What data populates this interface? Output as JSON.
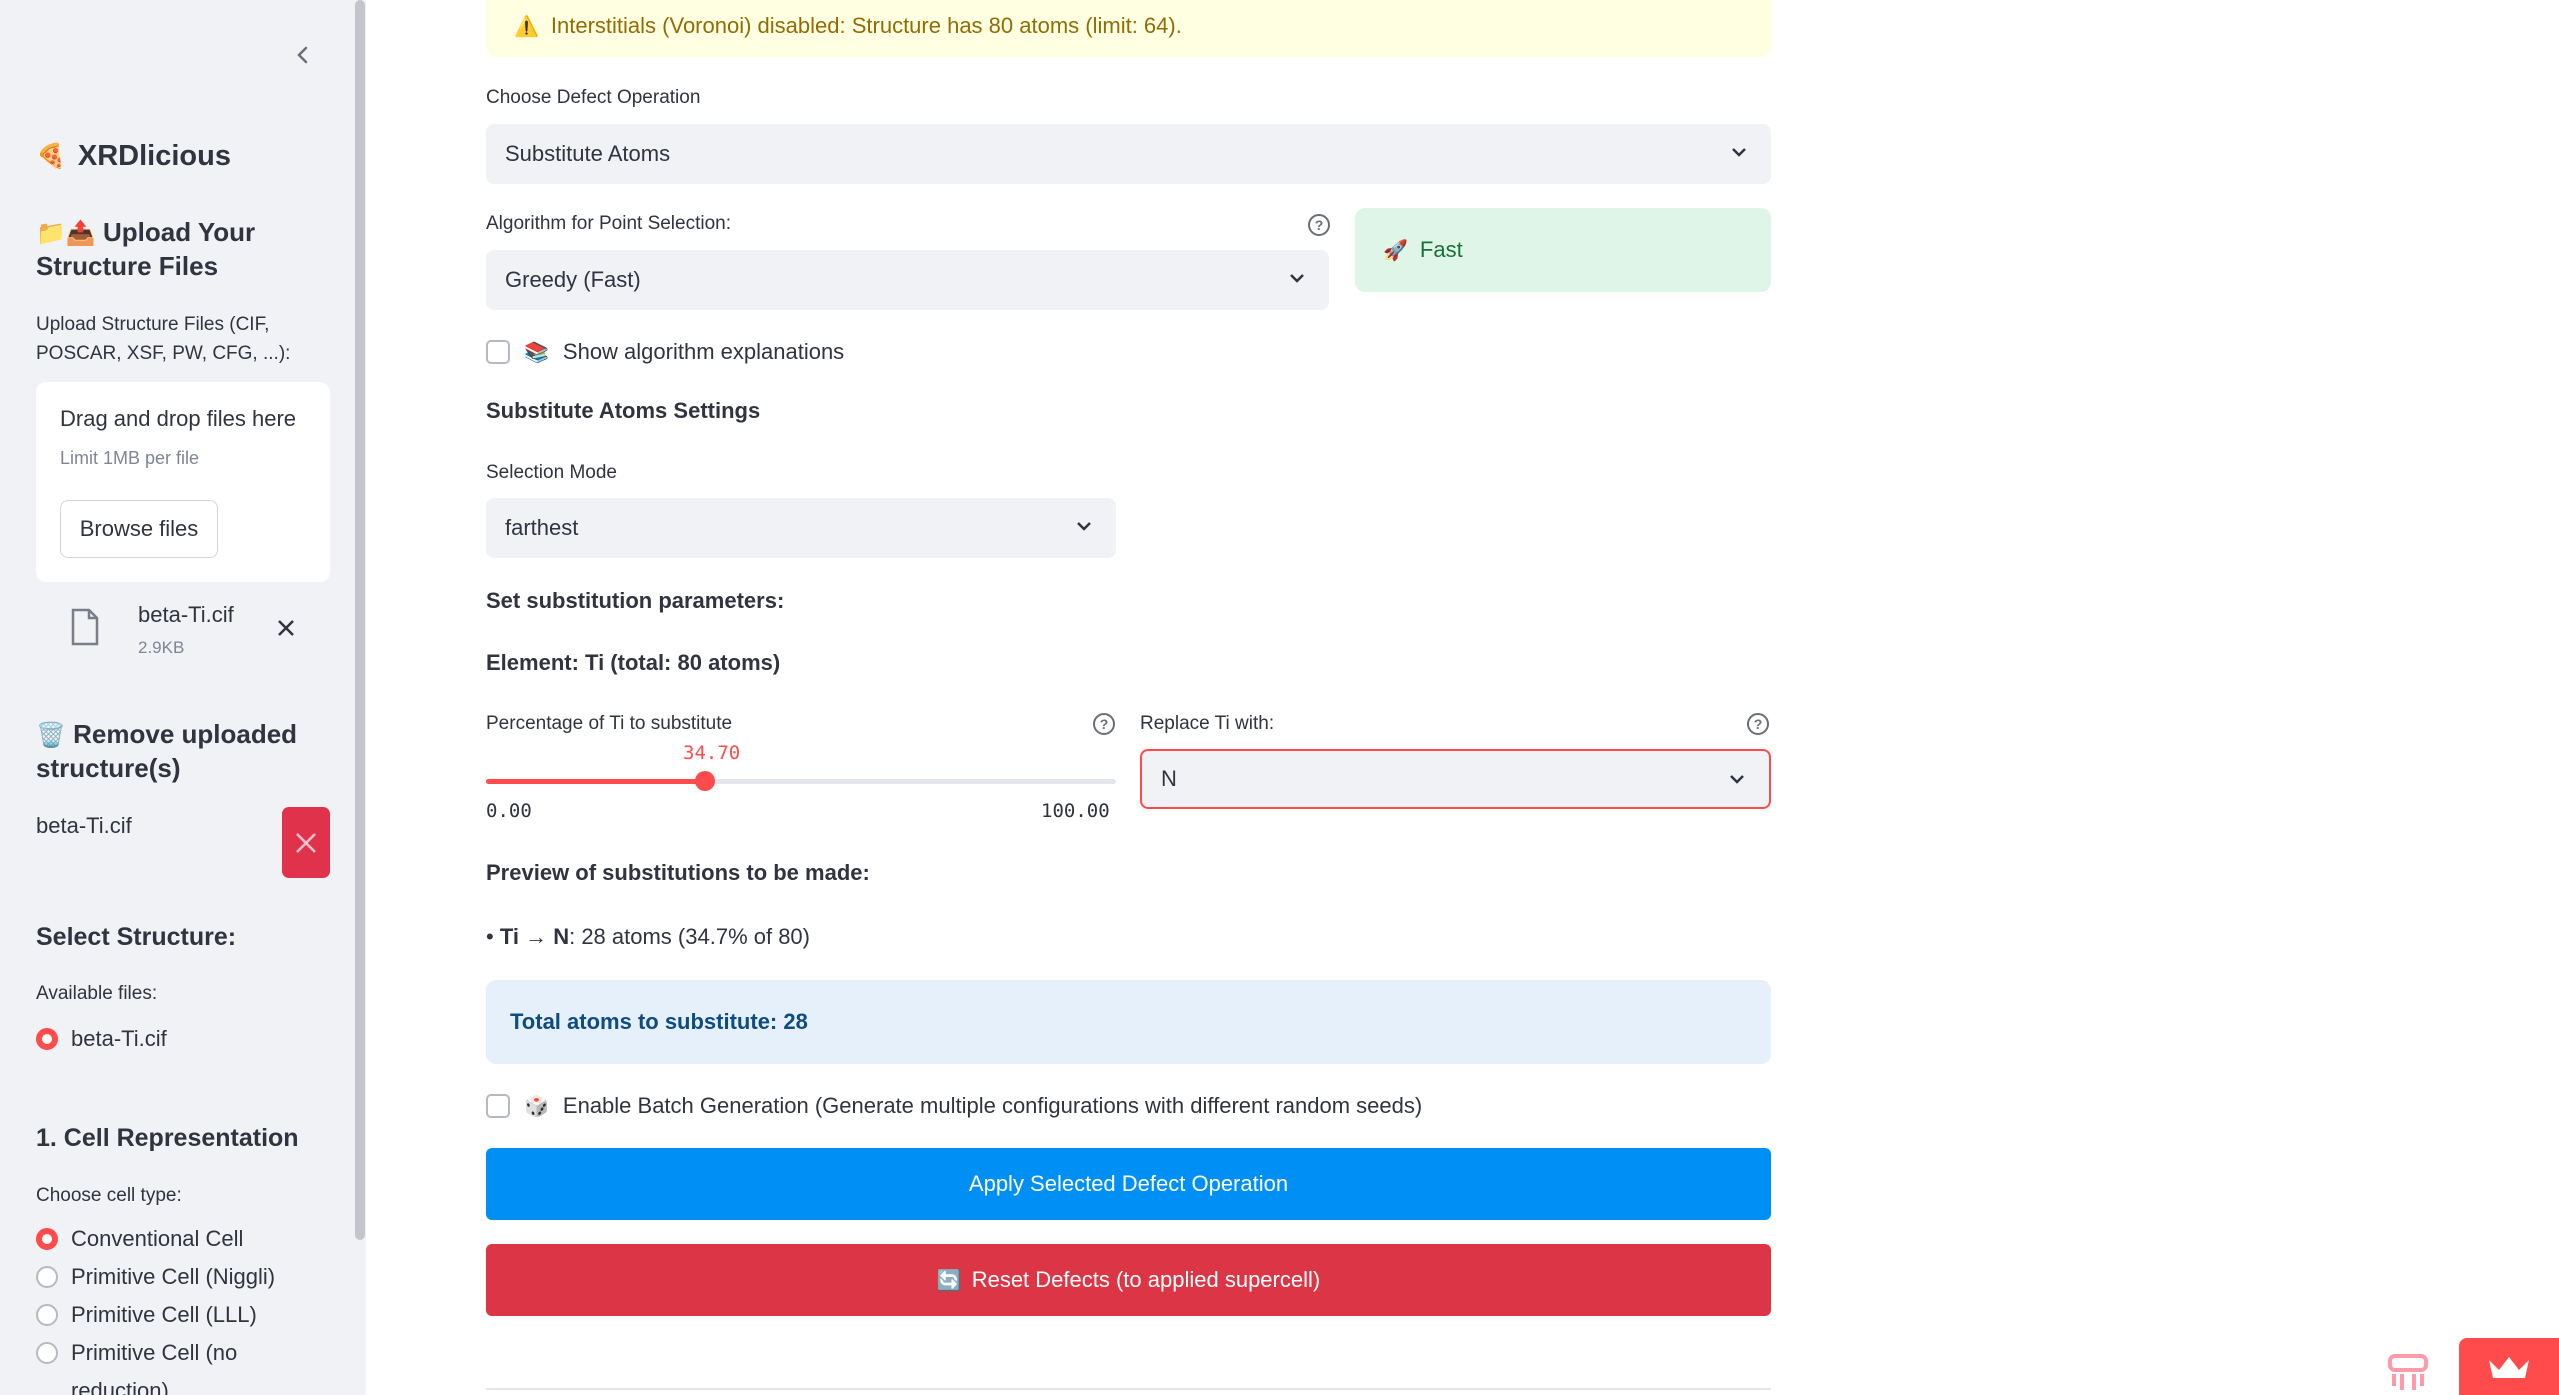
{
  "sidebar": {
    "brand": "XRDlicious",
    "upload_heading_line1": "Upload Your",
    "upload_heading_line2": "Structure Files",
    "upload_label_line1": "Upload Structure Files (CIF,",
    "upload_label_line2": "POSCAR, XSF, PW, CFG, ...):",
    "dropzone_title": "Drag and drop files here",
    "dropzone_limit": "Limit 1MB per file",
    "browse_label": "Browse files",
    "uploaded_file_name": "beta-Ti.cif",
    "uploaded_file_size": "2.9KB",
    "remove_heading_line1": "Remove uploaded",
    "remove_heading_line2": "structure(s)",
    "remove_file_name": "beta-Ti.cif",
    "select_heading": "Select Structure:",
    "available_label": "Available files:",
    "available_files": [
      "beta-Ti.cif"
    ],
    "cell_heading": "1. Cell Representation",
    "cell_type_label": "Choose cell type:",
    "cell_options": [
      "Conventional Cell",
      "Primitive Cell (Niggli)",
      "Primitive Cell (LLL)",
      "Primitive Cell (no",
      "reduction)"
    ],
    "cell_selected_index": 0
  },
  "main": {
    "warning_text": "Interstitials (Voronoi) disabled: Structure has 80 atoms (limit: 64).",
    "defect_op_label": "Choose Defect Operation",
    "defect_op_value": "Substitute Atoms",
    "algorithm_label": "Algorithm for Point Selection:",
    "algorithm_value": "Greedy (Fast)",
    "speed_badge": "Fast",
    "show_explanations_label": "Show algorithm explanations",
    "settings_heading": "Substitute Atoms Settings",
    "selection_mode_label": "Selection Mode",
    "selection_mode_value": "farthest",
    "set_params_heading": "Set substitution parameters:",
    "element_heading": "Element: Ti (total: 80 atoms)",
    "percentage_label": "Percentage of Ti to substitute",
    "slider": {
      "value": 34.7,
      "value_label": "34.70",
      "min_label": "0.00",
      "max_label": "100.00",
      "min": 0,
      "max": 100
    },
    "replace_label": "Replace Ti with:",
    "replace_value": "N",
    "preview_heading": "Preview of substitutions to be made:",
    "preview_bullet": "• ",
    "preview_bold": "Ti → N",
    "preview_rest": ": 28 atoms (34.7% of 80)",
    "total_info": "Total atoms to substitute: 28",
    "batch_label": "Enable Batch Generation (Generate multiple configurations with different random seeds)",
    "apply_button": "Apply Selected Defect Operation",
    "reset_button": "Reset Defects (to applied supercell)"
  },
  "colors": {
    "accent": "#ff4b4b",
    "primary_button": "#0090f5",
    "danger_button": "#dc3545",
    "warning_bg": "#ffffe2",
    "success_bg": "#dff5e8",
    "info_bg": "#e6f0fb"
  },
  "icons": {
    "collapse": "chevron-left-icon",
    "brand": "pizza-icon",
    "upload": "folder-upload-icon",
    "file": "file-icon",
    "remove": "wastebasket-icon",
    "warning": "warning-icon",
    "speed": "rocket-icon",
    "books": "books-icon",
    "dice": "dice-icon",
    "reset": "refresh-icon"
  }
}
